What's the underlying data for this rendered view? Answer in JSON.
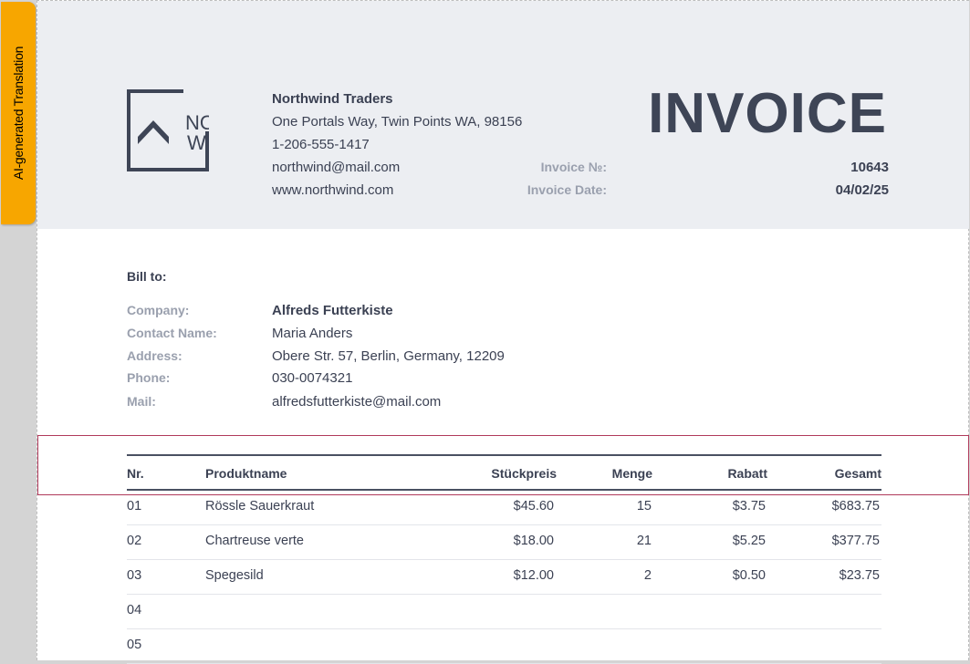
{
  "ai_tab": {
    "label": "AI-generated Translation",
    "color": "#f7a600"
  },
  "company": {
    "logo_line1": "NORTH",
    "logo_line2": "WIND",
    "name": "Northwind Traders",
    "address": "One Portals Way, Twin Points WA, 98156",
    "phone": "1-206-555-1417",
    "email": "northwind@mail.com",
    "website": "www.northwind.com"
  },
  "invoice": {
    "title": "INVOICE",
    "number_label": "Invoice №:",
    "number": "10643",
    "date_label": "Invoice Date:",
    "date": "04/02/25"
  },
  "bill_to": {
    "heading": "Bill to:",
    "rows": [
      {
        "label": "Company:",
        "value": "Alfreds Futterkiste"
      },
      {
        "label": "Contact Name:",
        "value": "Maria Anders"
      },
      {
        "label": "Address:",
        "value": "Obere Str. 57, Berlin, Germany, 12209"
      },
      {
        "label": "Phone:",
        "value": "030-0074321"
      },
      {
        "label": "Mail:",
        "value": "alfredsfutterkiste@mail.com"
      }
    ]
  },
  "table": {
    "headers": {
      "nr": "Nr.",
      "name": "Produktname",
      "price": "Stückpreis",
      "qty": "Menge",
      "discount": "Rabatt",
      "total": "Gesamt"
    },
    "rows": [
      {
        "nr": "01",
        "name": "Rössle Sauerkraut",
        "price": "$45.60",
        "qty": "15",
        "discount": "$3.75",
        "total": "$683.75"
      },
      {
        "nr": "02",
        "name": "Chartreuse verte",
        "price": "$18.00",
        "qty": "21",
        "discount": "$5.25",
        "total": "$377.75"
      },
      {
        "nr": "03",
        "name": "Spegesild",
        "price": "$12.00",
        "qty": "2",
        "discount": "$0.50",
        "total": "$23.75"
      },
      {
        "nr": "04",
        "name": "",
        "price": "",
        "qty": "",
        "discount": "",
        "total": ""
      },
      {
        "nr": "05",
        "name": "",
        "price": "",
        "qty": "",
        "discount": "",
        "total": ""
      }
    ]
  },
  "colors": {
    "header_band": "#eceef2",
    "text_dark": "#3b4153",
    "text_muted": "#9aa0ae",
    "selection": "#b03a5b"
  }
}
